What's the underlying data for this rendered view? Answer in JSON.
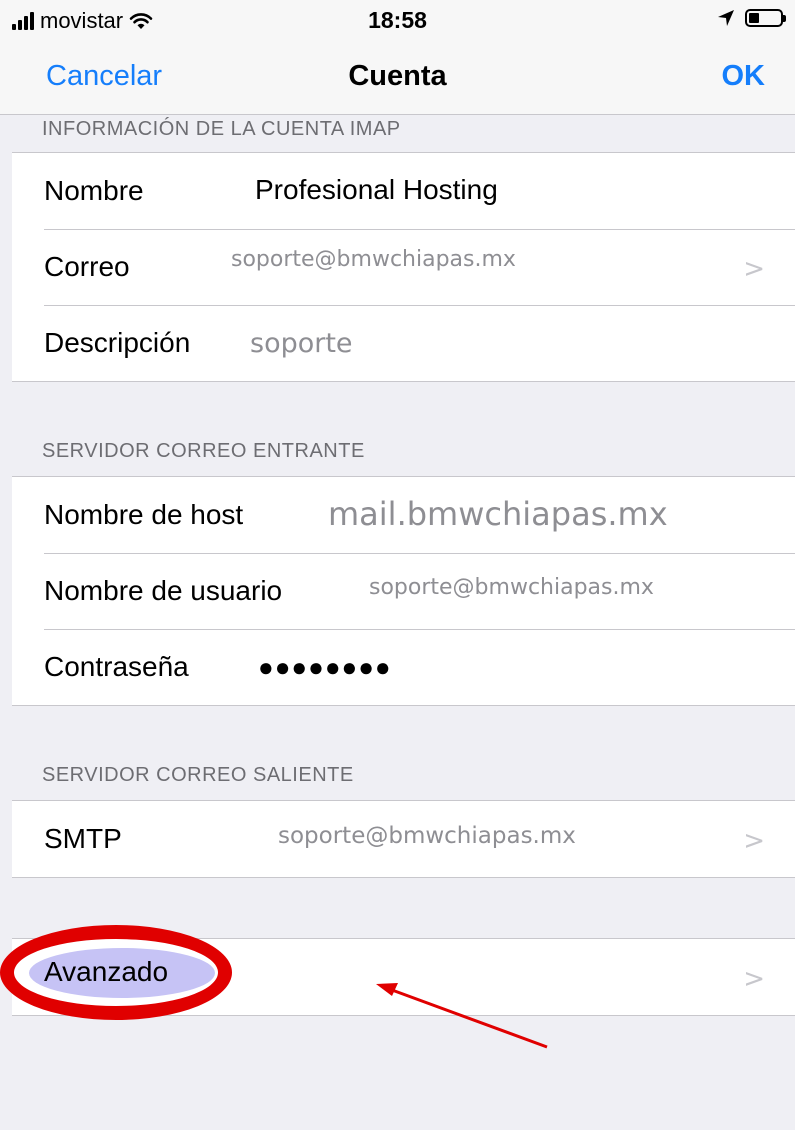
{
  "status_bar": {
    "carrier": "movistar",
    "time": "18:58"
  },
  "nav": {
    "cancel": "Cancelar",
    "title": "Cuenta",
    "ok": "OK"
  },
  "imap": {
    "header": "INFORMACIÓN DE LA CUENTA IMAP",
    "name_label": "Nombre",
    "name_value": "Profesional Hosting",
    "email_label": "Correo",
    "email_value": "soporte@bmwchiapas.mx",
    "desc_label": "Descripción",
    "desc_value": "soporte"
  },
  "incoming": {
    "header": "SERVIDOR CORREO ENTRANTE",
    "host_label": "Nombre de host",
    "host_value": "mail.bmwchiapas.mx",
    "user_label": "Nombre de usuario",
    "user_value": "soporte@bmwchiapas.mx",
    "pass_label": "Contraseña",
    "pass_value": "●●●●●●●●"
  },
  "outgoing": {
    "header": "SERVIDOR CORREO SALIENTE",
    "smtp_label": "SMTP",
    "smtp_value": "soporte@bmwchiapas.mx"
  },
  "advanced": {
    "label": "Avanzado"
  },
  "annotation": {
    "highlight_color": "#e00000"
  },
  "colors": {
    "accent": "#157efb",
    "background": "#efeff4"
  }
}
